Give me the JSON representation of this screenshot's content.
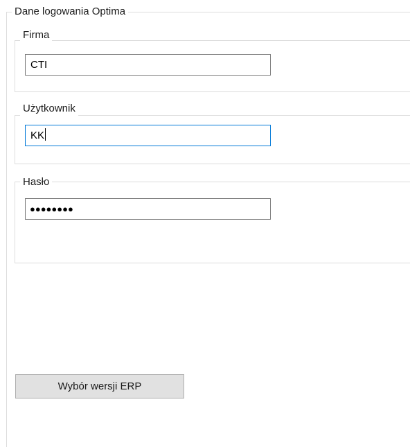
{
  "group": {
    "title": "Dane logowania Optima"
  },
  "firma": {
    "label": "Firma",
    "value": "CTI"
  },
  "uzytkownik": {
    "label": "Użytkownik",
    "value": "KK"
  },
  "haslo": {
    "label": "Hasło",
    "masked": "●●●●●●●●"
  },
  "button": {
    "label": "Wybór wersji ERP"
  },
  "colors": {
    "focus_border": "#0078d7",
    "button_bg": "#e1e1e1"
  }
}
